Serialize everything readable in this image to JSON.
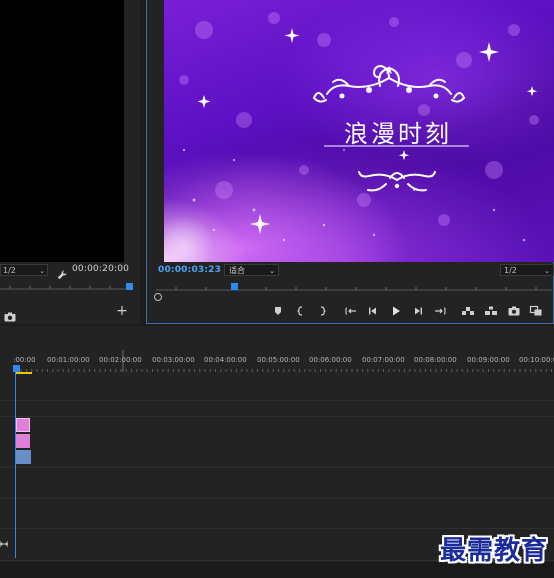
{
  "source_monitor": {
    "resolution": "1/2",
    "timecode": "00:00:20:00",
    "add_label": "+"
  },
  "program_monitor": {
    "timecode": "00:00:03:23",
    "zoom": "适合",
    "resolution": "1/2",
    "video_title": "浪漫时刻",
    "icons": [
      "marker-icon",
      "mark-in-icon",
      "mark-out-icon",
      "go-to-in-icon",
      "step-back-icon",
      "play-icon",
      "step-forward-icon",
      "go-to-out-icon",
      "lift-icon",
      "extract-icon",
      "export-frame-icon",
      "comparison-view-icon"
    ]
  },
  "timeline": {
    "ruler_labels": [
      ":00:00",
      "00:01:00:00",
      "00:02:00:00",
      "00:03:00:00",
      "00:04:00:00",
      "00:05:00:00",
      "00:06:00:00",
      "00:07:00:00",
      "00:08:00:00",
      "00:09:00:00",
      "00:10:00:00"
    ],
    "clip_colors": [
      "#e07fd8",
      "#e07fd8",
      "#6a8fc7"
    ],
    "accent": "#2d8ceb"
  },
  "watermark": "最需教育"
}
